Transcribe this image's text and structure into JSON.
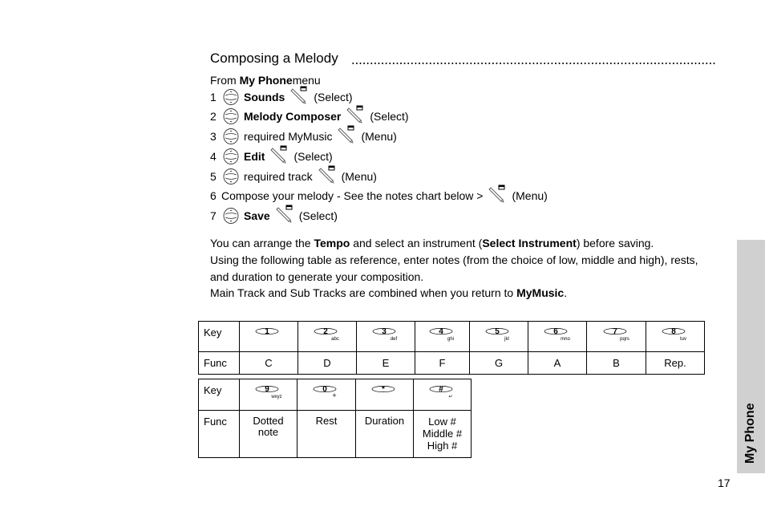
{
  "section": {
    "title": "Composing a Melody",
    "intro": {
      "prefix": "From ",
      "bold": "My Phone",
      "suffix": " menu"
    }
  },
  "steps": [
    {
      "num": "1",
      "nav_icon": "nav-scroll-icon",
      "label": "Sounds",
      "bold": true,
      "softkey_icon": "softkey-icon",
      "action": "(Select)"
    },
    {
      "num": "2",
      "nav_icon": "nav-scroll-icon",
      "label": "Melody Composer",
      "bold": true,
      "softkey_icon": "softkey-icon",
      "action": "(Select)"
    },
    {
      "num": "3",
      "nav_icon": "nav-scroll-icon",
      "label": "required MyMusic",
      "bold": false,
      "softkey_icon": "softkey-icon",
      "action": "(Menu)"
    },
    {
      "num": "4",
      "nav_icon": "nav-scroll-icon",
      "label": "Edit",
      "bold": true,
      "softkey_icon": "softkey-icon",
      "action": "(Select)"
    },
    {
      "num": "5",
      "nav_icon": "nav-scroll-icon",
      "label": "required track",
      "bold": false,
      "softkey_icon": "softkey-icon",
      "action": "(Menu)"
    },
    {
      "num": "6",
      "label": "Compose your melody - See the notes chart below >",
      "bold": false,
      "softkey_icon": "softkey-icon",
      "action": "(Menu)"
    },
    {
      "num": "7",
      "nav_icon": "nav-scroll-icon",
      "label": "Save",
      "bold": true,
      "softkey_icon": "softkey-icon",
      "action": "(Select)"
    }
  ],
  "paragraphs": {
    "p1": {
      "a": "You can arrange the ",
      "b1": "Tempo",
      "c": " and select an instrument (",
      "b2": "Select Instrument",
      "d": ") before saving."
    },
    "p2": "Using the following table as reference, enter notes (from the choice of low, middle and high), rests,",
    "p3": "and duration to generate your composition.",
    "p4": {
      "a": "Main Track and Sub Tracks are combined when you return to ",
      "b": "MyMusic",
      "c": "."
    }
  },
  "table1": {
    "key_label": "Key",
    "func_label": "Func",
    "columns": [
      {
        "digit": "1",
        "letters": "",
        "func": "C"
      },
      {
        "digit": "2",
        "letters": "abc",
        "func": "D"
      },
      {
        "digit": "3",
        "letters": "def",
        "func": "E"
      },
      {
        "digit": "4",
        "letters": "ghi",
        "func": "F"
      },
      {
        "digit": "5",
        "letters": "jkl",
        "func": "G"
      },
      {
        "digit": "6",
        "letters": "mno",
        "func": "A"
      },
      {
        "digit": "7",
        "letters": "pqrs",
        "func": "B"
      },
      {
        "digit": "8",
        "letters": "tuv",
        "func": "Rep."
      }
    ]
  },
  "table2": {
    "key_label": "Key",
    "func_label": "Func",
    "columns": [
      {
        "digit": "9",
        "letters": "wxyz",
        "func_lines": [
          "Dotted",
          "note"
        ]
      },
      {
        "digit": "0",
        "letters": "+",
        "func_lines": [
          "Rest"
        ]
      },
      {
        "digit": "*",
        "letters": "",
        "func_lines": [
          "Duration"
        ]
      },
      {
        "digit": "#",
        "letters": "↵",
        "func_lines": [
          "Low #",
          "Middle #",
          "High #"
        ]
      }
    ]
  },
  "side_tab": {
    "label": "My Phone",
    "color": "#d0d0d0"
  },
  "page_number": "17"
}
